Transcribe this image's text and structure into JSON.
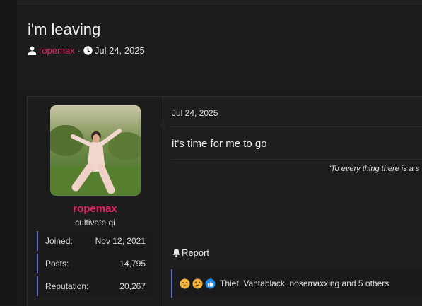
{
  "thread": {
    "title": "i'm leaving",
    "author": "ropemax",
    "separator": "·",
    "date": "Jul 24, 2025"
  },
  "post": {
    "date": "Jul 24, 2025",
    "body": "it's time for me to go",
    "quote": "\"To every thing there is a s",
    "report_label": "Report",
    "reactions": {
      "icons": [
        "frowning-face-icon",
        "thinking-face-icon",
        "thumbs-up-icon"
      ],
      "text": "Thief, Vantablack, nosemaxxing and 5 others"
    }
  },
  "user": {
    "name": "ropemax",
    "title": "cultivate qi",
    "stats": [
      {
        "label": "Joined:",
        "value": "Nov 12, 2021"
      },
      {
        "label": "Posts:",
        "value": "14,795"
      },
      {
        "label": "Reputation:",
        "value": "20,267"
      }
    ]
  },
  "colors": {
    "accent": "#e0245e",
    "stat_border": "#5c6bc0",
    "background": "#1a1a1b"
  }
}
